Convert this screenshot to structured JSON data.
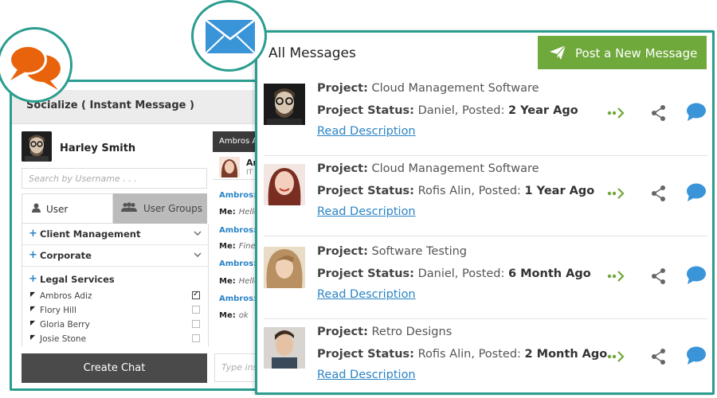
{
  "chat_panel": {
    "title": "Socialize ( Instant Message )",
    "current_user": "Harley Smith",
    "search_placeholder": "Search by Username . . .",
    "tabs": [
      {
        "label": "User",
        "icon": "user-icon"
      },
      {
        "label": "User Groups",
        "icon": "user-groups-icon"
      }
    ],
    "groups": [
      {
        "label": "Client Management"
      },
      {
        "label": "Corporate"
      },
      {
        "label": "Legal Services"
      }
    ],
    "members": [
      {
        "name": "Ambros Adiz",
        "checked": true
      },
      {
        "name": "Flory Hill",
        "checked": false
      },
      {
        "name": "Gloria Berry",
        "checked": false
      },
      {
        "name": "Josie Stone",
        "checked": false
      }
    ],
    "create_chat_label": "Create Chat",
    "conversation": {
      "header": "Ambros Adiz",
      "contact_name": "Ambros",
      "contact_sub": "IT (",
      "messages": [
        {
          "from": "Ambros:",
          "text": ""
        },
        {
          "from": "Me:",
          "text": "Hello"
        },
        {
          "from": "Ambros:",
          "text": ""
        },
        {
          "from": "Me:",
          "text": "Fine"
        },
        {
          "from": "Ambros:",
          "text": ""
        },
        {
          "from": "Me:",
          "text": "Hello"
        },
        {
          "from": "Ambros:",
          "text": ""
        },
        {
          "from": "Me:",
          "text": "ok"
        }
      ],
      "type_placeholder": "Type ins"
    }
  },
  "messages_panel": {
    "title": "All Messages",
    "post_button": "Post a New Message",
    "project_label": "Project:",
    "status_label": "Project Status:",
    "posted_label": "Posted:",
    "read_label": "Read Description",
    "items": [
      {
        "project": "Cloud Management Software",
        "author": "Daniel,",
        "posted": "2 Year Ago"
      },
      {
        "project": "Cloud Management Software",
        "author": "Rofis Alin,",
        "posted": "1 Year Ago"
      },
      {
        "project": "Software Testing",
        "author": "Daniel,",
        "posted": "6 Month Ago"
      },
      {
        "project": "Retro Designs",
        "author": "Rofis Alin,",
        "posted": "2 Month Ago"
      }
    ]
  },
  "colors": {
    "accent_teal": "#2a9d8f",
    "post_green": "#6fa83b",
    "link_blue": "#2b84c6",
    "chat_orange": "#e8630c",
    "mail_blue": "#3a94d8"
  }
}
